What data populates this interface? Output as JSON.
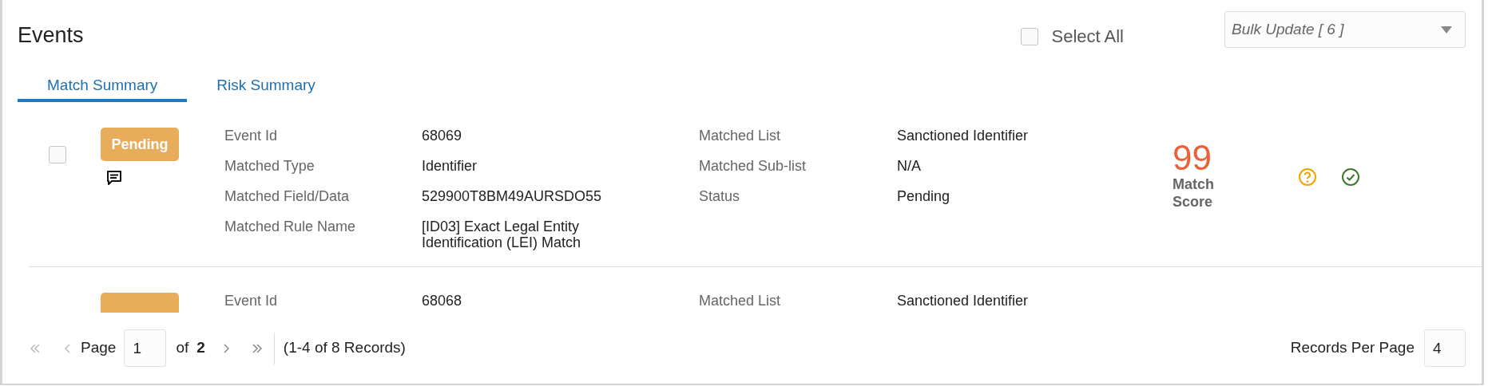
{
  "header": {
    "title": "Events",
    "select_all": {
      "label": "Select All",
      "checked": false
    },
    "bulk_update": {
      "value": "Bulk Update [ 6 ]"
    }
  },
  "tabs": [
    {
      "label": "Match Summary",
      "selected": true
    },
    {
      "label": "Risk Summary",
      "selected": false
    }
  ],
  "events": [
    {
      "checked": false,
      "badge": {
        "label": "Pending",
        "color": "#e8ad5b"
      },
      "has_comment": true,
      "fields": [
        {
          "label": "Event Id",
          "value": "68069"
        },
        {
          "label": "Matched Type",
          "value": "Identifier"
        },
        {
          "label": "Matched Field/Data",
          "value": "529900T8BM49AURSDO55"
        },
        {
          "label": "Matched Rule Name",
          "value": "[ID03] Exact Legal Entity Identification (LEI) Match"
        }
      ],
      "fields_2": [
        {
          "label": "Matched List",
          "value": "Sanctioned Identifier"
        },
        {
          "label": "Matched Sub-list",
          "value": "N/A"
        },
        {
          "label": "Status",
          "value": "Pending"
        }
      ],
      "score": {
        "value": "99",
        "label": "Match Score"
      },
      "actions": true
    },
    {
      "badge": {
        "color": "#e8ad5b"
      },
      "fields": [
        {
          "label": "Event Id",
          "value": "68068"
        }
      ],
      "fields_2": [
        {
          "label": "Matched List",
          "value": "Sanctioned Identifier"
        }
      ]
    }
  ],
  "pagination": {
    "page_label": "Page",
    "page": "1",
    "of_label": "of",
    "total_pages": "2",
    "records": "(1-4 of 8 Records)",
    "per_page_label": "Records Per Page",
    "per_page": "4"
  }
}
